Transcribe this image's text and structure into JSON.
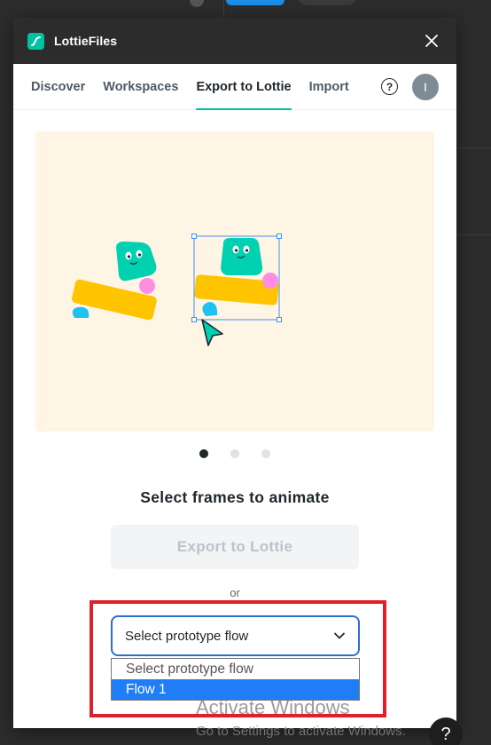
{
  "window": {
    "title": "LottieFiles"
  },
  "tabs": [
    {
      "label": "Discover"
    },
    {
      "label": "Workspaces"
    },
    {
      "label": "Export to Lottie"
    },
    {
      "label": "Import"
    }
  ],
  "header": {
    "help_glyph": "?",
    "avatar_initial": "I"
  },
  "carousel": {
    "total": 3,
    "active_index": 0
  },
  "main": {
    "heading": "Select frames to animate",
    "export_button": "Export to Lottie",
    "or_text": "or"
  },
  "flow_select": {
    "value": "Select prototype flow",
    "options": [
      "Select prototype flow",
      "Flow 1"
    ],
    "highlighted_option": "Flow 1"
  },
  "os_watermark": {
    "title": "Activate Windows",
    "subtitle": "Go to Settings to activate Windows."
  },
  "corner_help_glyph": "?",
  "colors": {
    "brand": "#00c1a2",
    "accent_blue": "#2b6fd0",
    "highlight_red": "#e01f26",
    "illustration_bg": "#fff5e5",
    "shape_yellow": "#ffc400",
    "shape_teal": "#00d1b0",
    "shape_pink": "#ff8ee3",
    "shape_blue": "#1ec1f0"
  },
  "icons": {
    "logo": "lottiefiles-logo-icon",
    "close": "close-icon",
    "help": "help-circle-icon",
    "dropdown": "chevron-down-icon",
    "cursor": "cursor-arrow-icon"
  }
}
